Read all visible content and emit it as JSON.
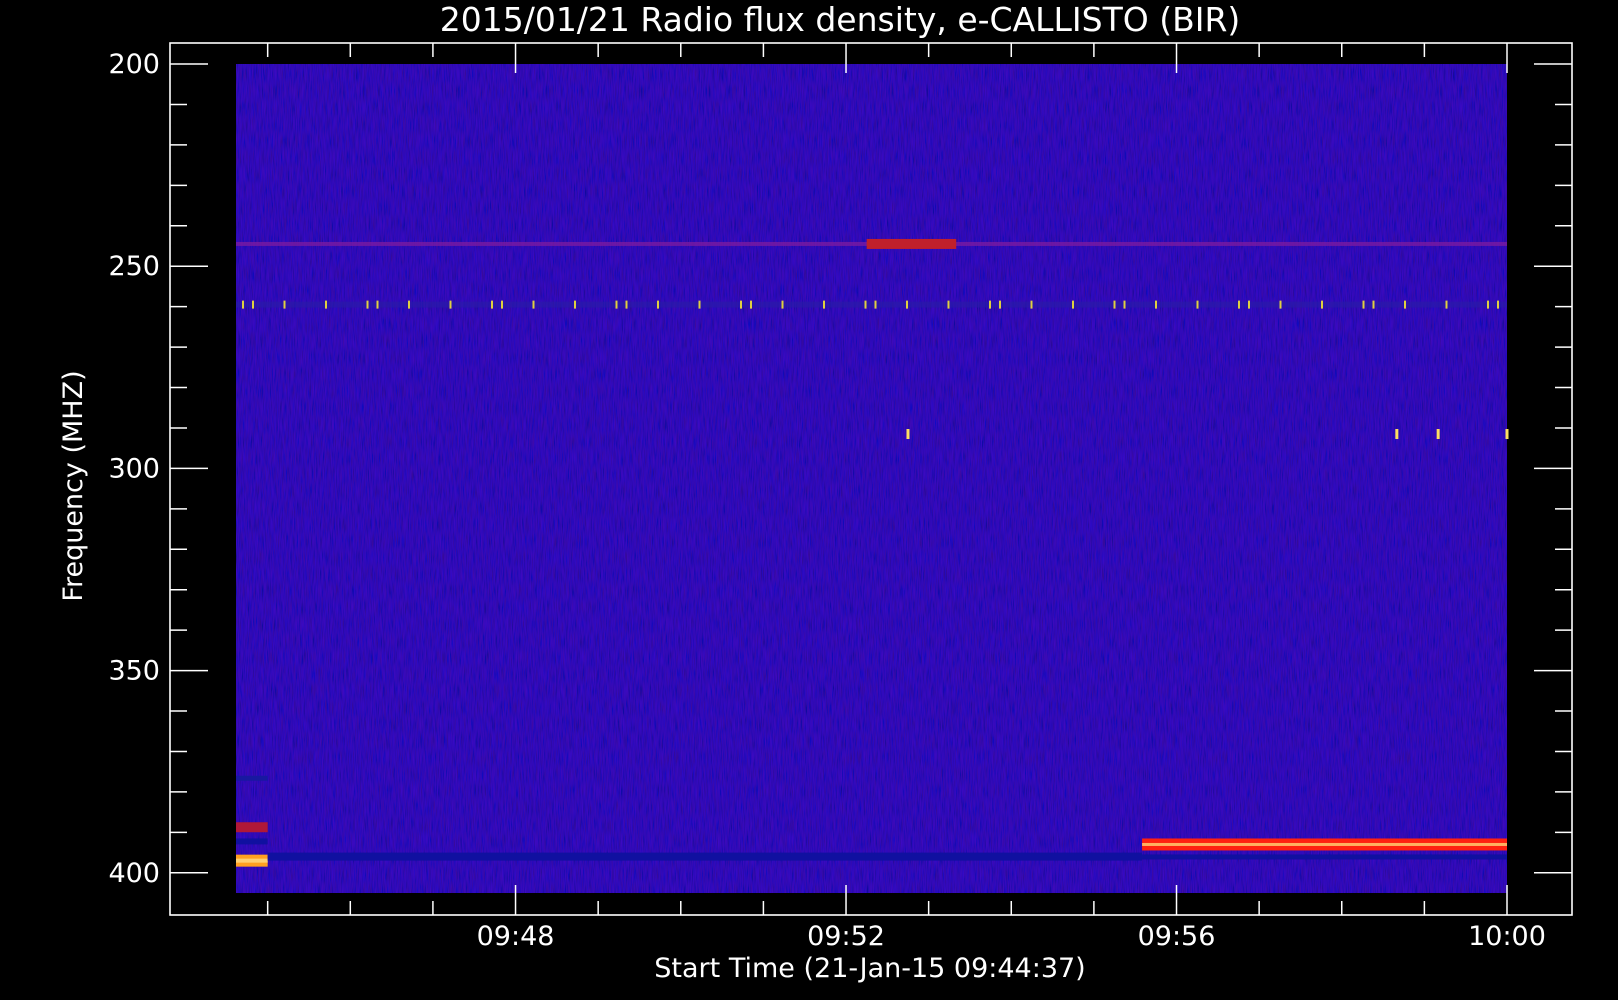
{
  "chart_data": {
    "type": "heatmap",
    "title": "2015/01/21  Radio flux density, e-CALLISTO (BIR)",
    "xlabel": "Start Time (21-Jan-15 09:44:37)",
    "ylabel": "Frequency (MHZ)",
    "x_unit": "time (HH:MM)",
    "y_unit": "MHz",
    "xlim": [
      "09:44:37",
      "10:00:00"
    ],
    "ylim": [
      200,
      405
    ],
    "y_inverted": true,
    "x_ticks": [
      "09:48",
      "09:52",
      "09:56",
      "10:00"
    ],
    "y_ticks": [
      200,
      250,
      300,
      350,
      400
    ],
    "colormap": "blue-red-yellow (background blue, intense emission red/orange/yellow)",
    "background_color": "#1a10f0",
    "features": [
      {
        "label": "narrowband interference",
        "freq_mhz": 244.5,
        "time_start": "09:44:37",
        "time_end": "10:00:00",
        "intensity": "weak",
        "color": "#7a1aa0"
      },
      {
        "label": "brightening",
        "freq_mhz": 244.5,
        "time_start": "09:52:15",
        "time_end": "09:53:20",
        "intensity": "moderate",
        "color": "#c0202c"
      },
      {
        "label": "periodic spikes",
        "freq_mhz": 259.5,
        "time_start": "09:44:37",
        "time_end": "10:00:00",
        "intensity": "moderate",
        "color": "#e0d040"
      },
      {
        "label": "isolated spikes",
        "freq_mhz": 291.5,
        "times": [
          "09:52:45",
          "09:58:40",
          "09:59:10",
          "10:00:00"
        ],
        "intensity": "strong",
        "color": "#ffe060"
      },
      {
        "label": "band at low-frequency edge",
        "freq_mhz": 397,
        "time_start": "09:44:37",
        "time_end": "09:45:00",
        "intensity": "strong",
        "color": "#ffa020"
      },
      {
        "label": "dark band",
        "freq_mhz": 396,
        "time_start": "09:45:00",
        "time_end": "09:55:35",
        "intensity": "low",
        "color": "#1010a0"
      },
      {
        "label": "strong interference band",
        "freq_mhz": 393,
        "time_start": "09:55:35",
        "time_end": "10:00:00",
        "intensity": "strong",
        "color": "#ff2010"
      }
    ],
    "grid": false,
    "legend": "none"
  }
}
